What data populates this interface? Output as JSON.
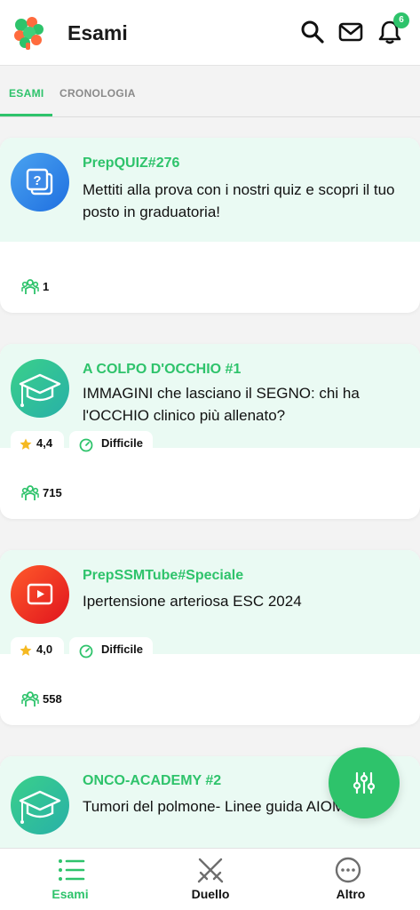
{
  "header": {
    "title": "Esami",
    "notification_count": "6"
  },
  "tabs": [
    {
      "label": "ESAMI",
      "active": true
    },
    {
      "label": "CRONOLOGIA",
      "active": false
    }
  ],
  "cards": [
    {
      "tag": "PrepQUIZ#276",
      "description": "Mettiti alla prova con i nostri quiz e scopri il tuo posto in graduatoria!",
      "participants": "1",
      "icon": "quiz-icon",
      "color": "#2f7de1"
    },
    {
      "tag": "A COLPO D'OCCHIO #1",
      "description": "IMMAGINI che lasciano il SEGNO: chi ha l'OCCHIO clinico più allenato?",
      "rating": "4,4",
      "difficulty": "Difficile",
      "participants": "715",
      "icon": "graduation-cap-icon",
      "color": "#2ec36b"
    },
    {
      "tag": "PrepSSMTube#Speciale",
      "description": "Ipertensione arteriosa ESC 2024",
      "rating": "4,0",
      "difficulty": "Difficile",
      "participants": "558",
      "icon": "video-icon",
      "color": "#e8341e"
    },
    {
      "tag": "ONCO-ACADEMY #2",
      "description": "Tumori del polmone- Linee guida AIOM 2024",
      "icon": "graduation-cap-icon",
      "color": "#2ec36b"
    }
  ],
  "bottom_nav": [
    {
      "label": "Esami",
      "icon": "list-icon",
      "active": true
    },
    {
      "label": "Duello",
      "icon": "swords-icon",
      "active": false
    },
    {
      "label": "Altro",
      "icon": "more-icon",
      "active": false
    }
  ],
  "colors": {
    "accent": "#2ec36b",
    "card_top": "#eafaf3",
    "star": "#f5b921"
  }
}
